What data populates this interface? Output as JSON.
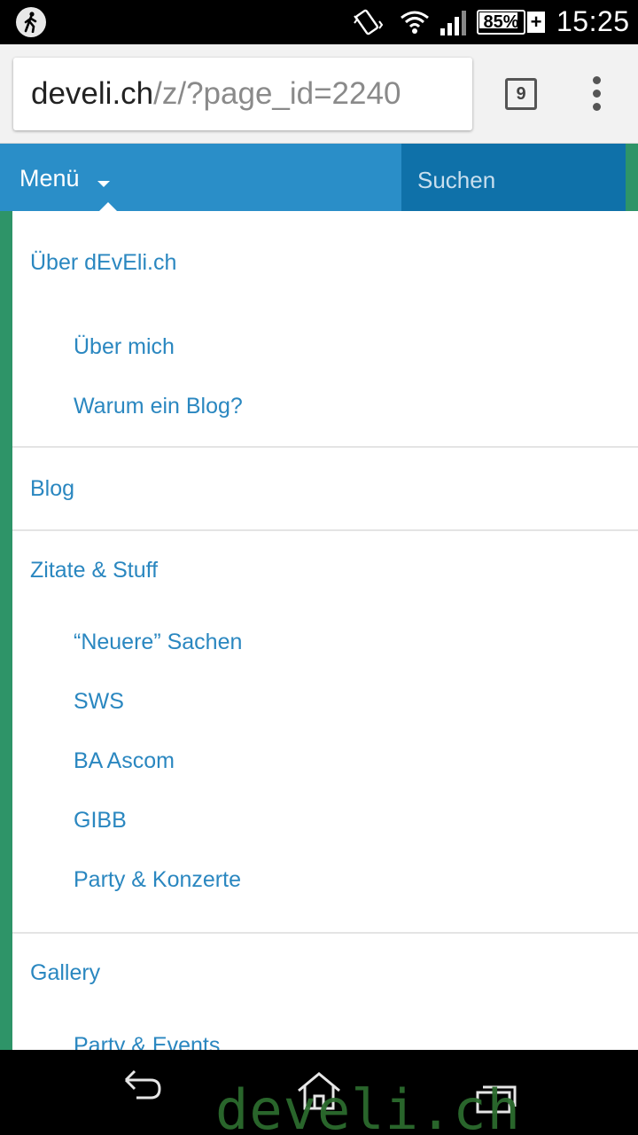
{
  "status_bar": {
    "battery_percent": "85%",
    "battery_plus": "+",
    "time": "15:25"
  },
  "browser": {
    "url_domain": "develi.ch",
    "url_path": "/z/?page_id=2240",
    "tab_count": "9"
  },
  "navbar": {
    "menu_label": "Menü",
    "search_placeholder": "Suchen"
  },
  "menu": {
    "sections": [
      {
        "label": "Über dEvEli.ch",
        "children": [
          "Über mich",
          "Warum ein Blog?"
        ]
      },
      {
        "label": "Blog",
        "children": []
      },
      {
        "label": "Zitate & Stuff",
        "children": [
          "“Neuere” Sachen",
          "SWS",
          "BA Ascom",
          "GIBB",
          "Party & Konzerte"
        ]
      },
      {
        "label": "Gallery",
        "children": [
          "Party & Events"
        ]
      }
    ]
  },
  "watermark": "develi.ch",
  "colors": {
    "navbar": "#2a8ec8",
    "search_bg": "#0f71a9",
    "link": "#2a87c0",
    "page_bg": "#2e9468"
  }
}
